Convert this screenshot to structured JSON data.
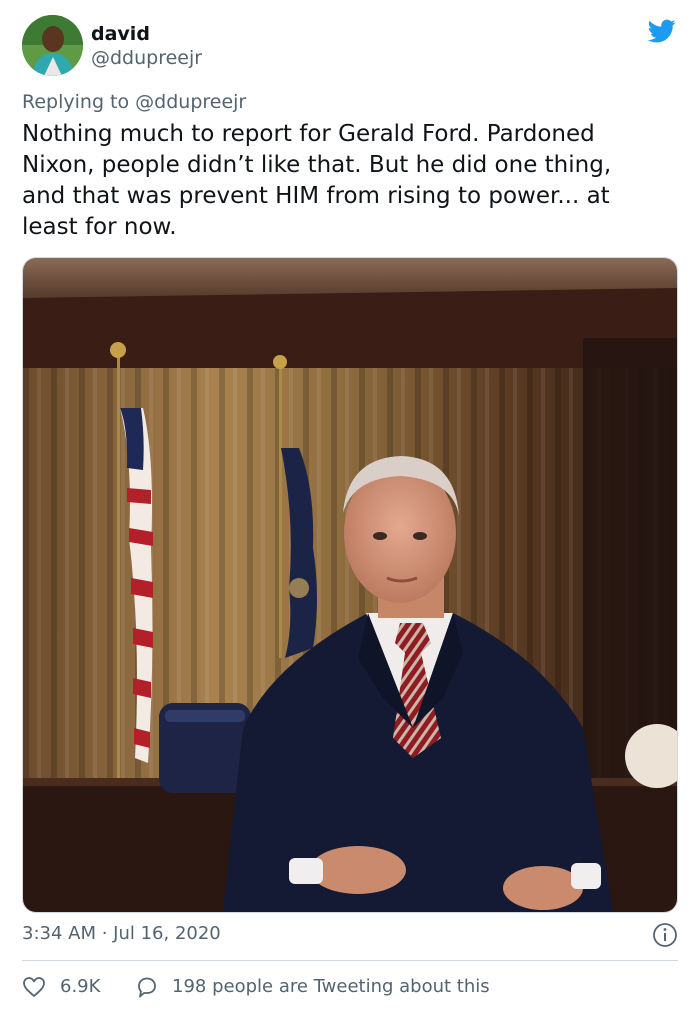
{
  "author": {
    "display_name": "david",
    "handle": "@ddupreejr",
    "avatar_icon": "user-avatar-photo"
  },
  "brand": {
    "icon": "twitter-bird-icon",
    "color": "#1d9bf0"
  },
  "reply_context": "Replying to @ddupreejr",
  "tweet_text_lines": [
    "Nothing much to report for Gerald Ford. Pardoned",
    "Nixon, people didn’t like that. But he did one thing,",
    "and that was prevent HIM from rising to power... at",
    "least for now."
  ],
  "media": {
    "type": "photo",
    "subject": "portrait-photo"
  },
  "meta": {
    "timestamp": "3:34 AM · Jul 16, 2020",
    "info_icon": "info-icon"
  },
  "actions": {
    "like_icon": "heart-icon",
    "like_count": "6.9K",
    "reply_icon": "speech-bubble-icon",
    "tweeting_text": "198 people are Tweeting about this"
  },
  "colors": {
    "text_primary": "#0f1419",
    "text_secondary": "#536471",
    "divider": "#cfd9de"
  }
}
